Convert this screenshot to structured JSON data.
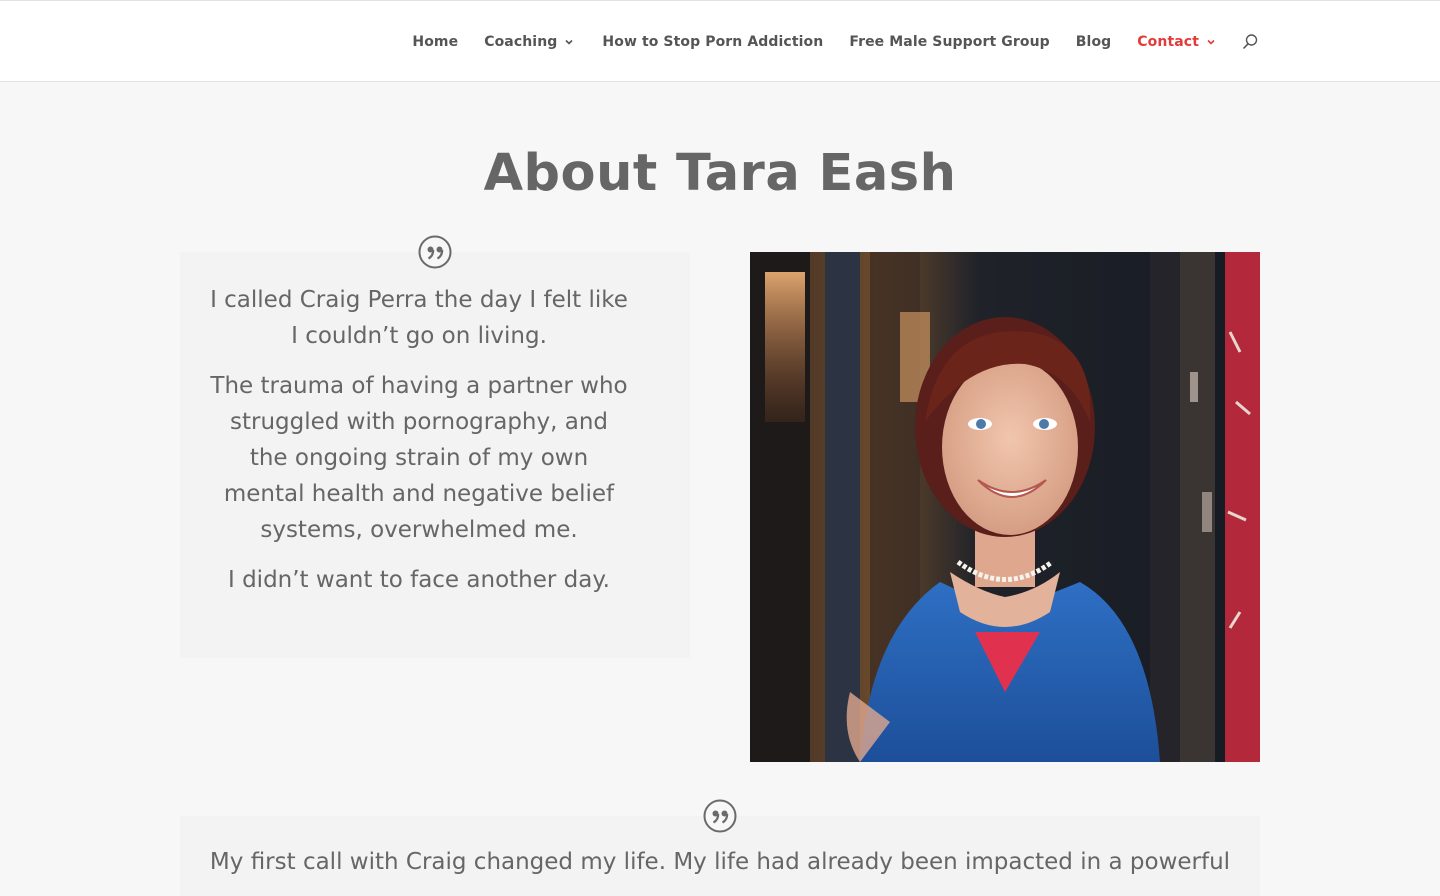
{
  "nav": {
    "items": [
      {
        "label": "Home",
        "has_dropdown": false,
        "active": false
      },
      {
        "label": "Coaching",
        "has_dropdown": true,
        "active": false
      },
      {
        "label": "How to Stop Porn Addiction",
        "has_dropdown": false,
        "active": false
      },
      {
        "label": "Free Male Support Group",
        "has_dropdown": false,
        "active": false
      },
      {
        "label": "Blog",
        "has_dropdown": false,
        "active": false
      },
      {
        "label": "Contact",
        "has_dropdown": true,
        "active": true
      }
    ],
    "search_icon": "search-icon"
  },
  "page": {
    "title": "About Tara Eash"
  },
  "testimonial_1": {
    "icon": "quote-icon",
    "paragraphs": [
      "I called Craig Perra the day I felt like I couldn’t go on living.",
      "The trauma of having a partner who struggled with pornography, and the ongoing strain of my own mental health and negative belief systems, overwhelmed me.",
      "I didn’t want to face another day."
    ]
  },
  "photo": {
    "subject": "portrait-photo"
  },
  "testimonial_2": {
    "icon": "quote-icon",
    "text": "My first call with Craig changed my life. My life had already been impacted in a powerful"
  },
  "colors": {
    "accent": "#e23b3b",
    "nav_text": "#555555",
    "body_text": "#666666",
    "background": "#f7f7f7",
    "card": "#f3f3f3"
  }
}
